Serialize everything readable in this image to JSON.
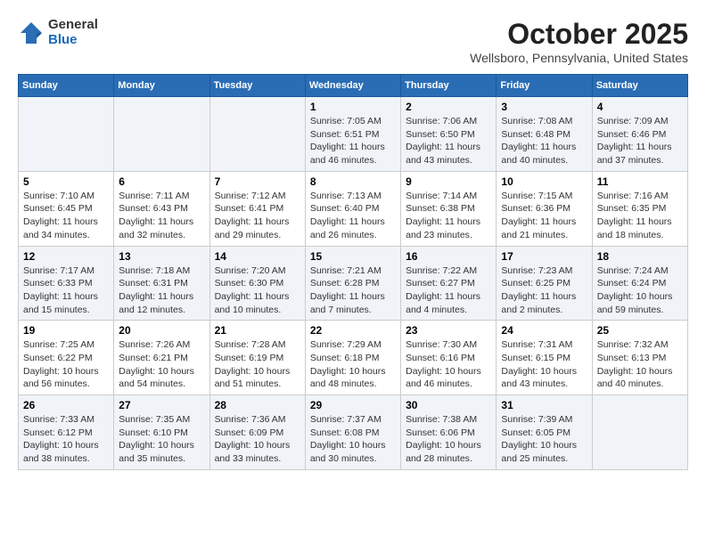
{
  "logo": {
    "general": "General",
    "blue": "Blue"
  },
  "title": "October 2025",
  "location": "Wellsboro, Pennsylvania, United States",
  "days_of_week": [
    "Sunday",
    "Monday",
    "Tuesday",
    "Wednesday",
    "Thursday",
    "Friday",
    "Saturday"
  ],
  "weeks": [
    [
      {
        "num": "",
        "info": ""
      },
      {
        "num": "",
        "info": ""
      },
      {
        "num": "",
        "info": ""
      },
      {
        "num": "1",
        "info": "Sunrise: 7:05 AM\nSunset: 6:51 PM\nDaylight: 11 hours and 46 minutes."
      },
      {
        "num": "2",
        "info": "Sunrise: 7:06 AM\nSunset: 6:50 PM\nDaylight: 11 hours and 43 minutes."
      },
      {
        "num": "3",
        "info": "Sunrise: 7:08 AM\nSunset: 6:48 PM\nDaylight: 11 hours and 40 minutes."
      },
      {
        "num": "4",
        "info": "Sunrise: 7:09 AM\nSunset: 6:46 PM\nDaylight: 11 hours and 37 minutes."
      }
    ],
    [
      {
        "num": "5",
        "info": "Sunrise: 7:10 AM\nSunset: 6:45 PM\nDaylight: 11 hours and 34 minutes."
      },
      {
        "num": "6",
        "info": "Sunrise: 7:11 AM\nSunset: 6:43 PM\nDaylight: 11 hours and 32 minutes."
      },
      {
        "num": "7",
        "info": "Sunrise: 7:12 AM\nSunset: 6:41 PM\nDaylight: 11 hours and 29 minutes."
      },
      {
        "num": "8",
        "info": "Sunrise: 7:13 AM\nSunset: 6:40 PM\nDaylight: 11 hours and 26 minutes."
      },
      {
        "num": "9",
        "info": "Sunrise: 7:14 AM\nSunset: 6:38 PM\nDaylight: 11 hours and 23 minutes."
      },
      {
        "num": "10",
        "info": "Sunrise: 7:15 AM\nSunset: 6:36 PM\nDaylight: 11 hours and 21 minutes."
      },
      {
        "num": "11",
        "info": "Sunrise: 7:16 AM\nSunset: 6:35 PM\nDaylight: 11 hours and 18 minutes."
      }
    ],
    [
      {
        "num": "12",
        "info": "Sunrise: 7:17 AM\nSunset: 6:33 PM\nDaylight: 11 hours and 15 minutes."
      },
      {
        "num": "13",
        "info": "Sunrise: 7:18 AM\nSunset: 6:31 PM\nDaylight: 11 hours and 12 minutes."
      },
      {
        "num": "14",
        "info": "Sunrise: 7:20 AM\nSunset: 6:30 PM\nDaylight: 11 hours and 10 minutes."
      },
      {
        "num": "15",
        "info": "Sunrise: 7:21 AM\nSunset: 6:28 PM\nDaylight: 11 hours and 7 minutes."
      },
      {
        "num": "16",
        "info": "Sunrise: 7:22 AM\nSunset: 6:27 PM\nDaylight: 11 hours and 4 minutes."
      },
      {
        "num": "17",
        "info": "Sunrise: 7:23 AM\nSunset: 6:25 PM\nDaylight: 11 hours and 2 minutes."
      },
      {
        "num": "18",
        "info": "Sunrise: 7:24 AM\nSunset: 6:24 PM\nDaylight: 10 hours and 59 minutes."
      }
    ],
    [
      {
        "num": "19",
        "info": "Sunrise: 7:25 AM\nSunset: 6:22 PM\nDaylight: 10 hours and 56 minutes."
      },
      {
        "num": "20",
        "info": "Sunrise: 7:26 AM\nSunset: 6:21 PM\nDaylight: 10 hours and 54 minutes."
      },
      {
        "num": "21",
        "info": "Sunrise: 7:28 AM\nSunset: 6:19 PM\nDaylight: 10 hours and 51 minutes."
      },
      {
        "num": "22",
        "info": "Sunrise: 7:29 AM\nSunset: 6:18 PM\nDaylight: 10 hours and 48 minutes."
      },
      {
        "num": "23",
        "info": "Sunrise: 7:30 AM\nSunset: 6:16 PM\nDaylight: 10 hours and 46 minutes."
      },
      {
        "num": "24",
        "info": "Sunrise: 7:31 AM\nSunset: 6:15 PM\nDaylight: 10 hours and 43 minutes."
      },
      {
        "num": "25",
        "info": "Sunrise: 7:32 AM\nSunset: 6:13 PM\nDaylight: 10 hours and 40 minutes."
      }
    ],
    [
      {
        "num": "26",
        "info": "Sunrise: 7:33 AM\nSunset: 6:12 PM\nDaylight: 10 hours and 38 minutes."
      },
      {
        "num": "27",
        "info": "Sunrise: 7:35 AM\nSunset: 6:10 PM\nDaylight: 10 hours and 35 minutes."
      },
      {
        "num": "28",
        "info": "Sunrise: 7:36 AM\nSunset: 6:09 PM\nDaylight: 10 hours and 33 minutes."
      },
      {
        "num": "29",
        "info": "Sunrise: 7:37 AM\nSunset: 6:08 PM\nDaylight: 10 hours and 30 minutes."
      },
      {
        "num": "30",
        "info": "Sunrise: 7:38 AM\nSunset: 6:06 PM\nDaylight: 10 hours and 28 minutes."
      },
      {
        "num": "31",
        "info": "Sunrise: 7:39 AM\nSunset: 6:05 PM\nDaylight: 10 hours and 25 minutes."
      },
      {
        "num": "",
        "info": ""
      }
    ]
  ]
}
